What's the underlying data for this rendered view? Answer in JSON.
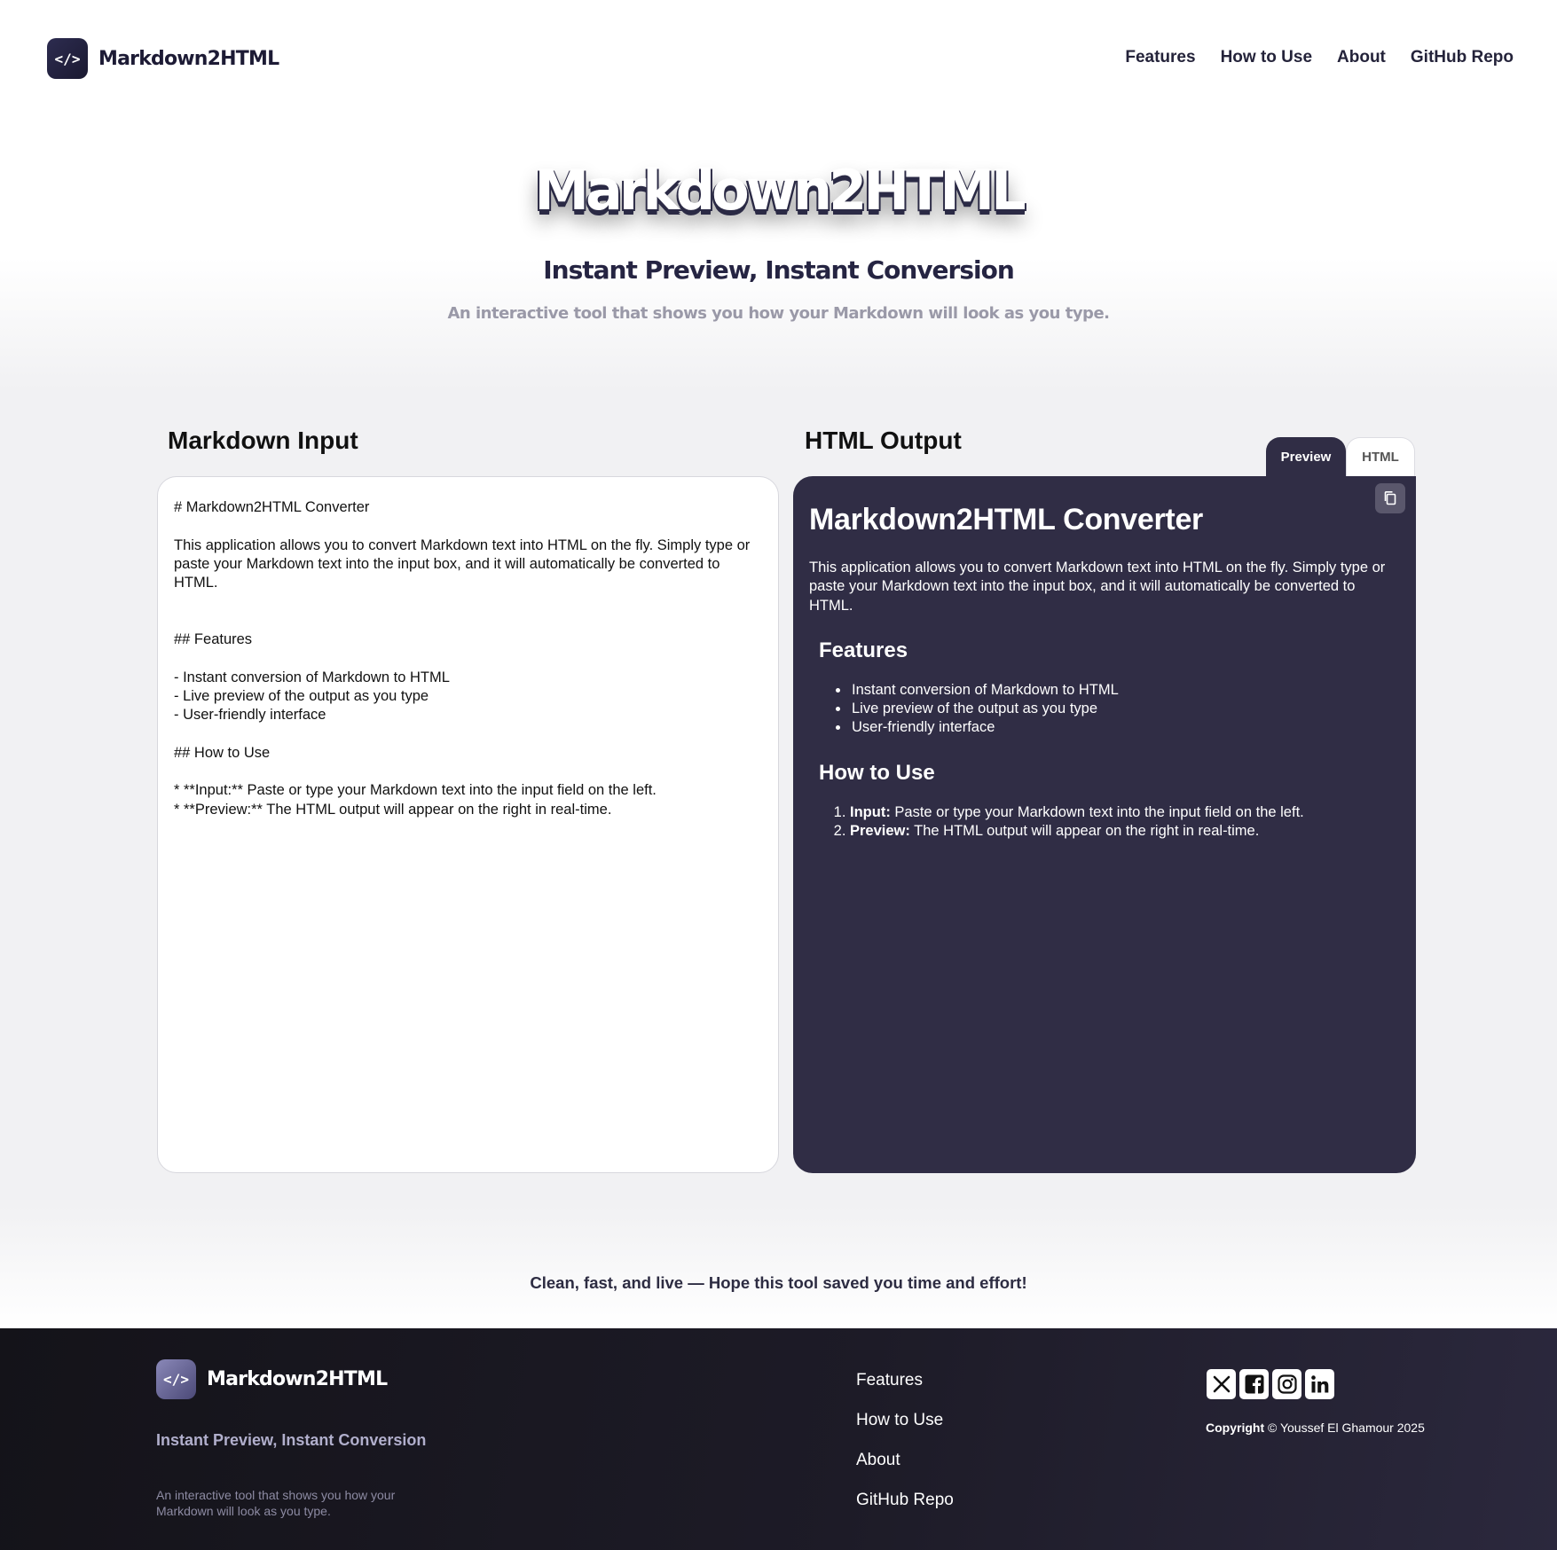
{
  "app": {
    "brand": "Markdown2HTML",
    "logo_glyph": "</>"
  },
  "nav": {
    "items": [
      "Features",
      "How to Use",
      "About",
      "GitHub Repo"
    ]
  },
  "hero": {
    "title": "Markdown2HTML",
    "subtitle": "Instant Preview, Instant Conversion",
    "tagline": "An interactive tool that shows you how your Markdown will look as you type."
  },
  "input_panel": {
    "title": "Markdown Input",
    "value": "# Markdown2HTML Converter\n\nThis application allows you to convert Markdown text into HTML on the fly. Simply type or paste your Markdown text into the input box, and it will automatically be converted to HTML.\n\n\n## Features\n\n- Instant conversion of Markdown to HTML\n- Live preview of the output as you type\n- User-friendly interface\n\n## How to Use\n\n* **Input:** Paste or type your Markdown text into the input field on the left.\n* **Preview:** The HTML output will appear on the right in real-time."
  },
  "output_panel": {
    "title": "HTML Output",
    "tabs": [
      "Preview",
      "HTML"
    ],
    "active_tab": "Preview",
    "copy_icon": "copy-icon",
    "preview": {
      "h1": "Markdown2HTML Converter",
      "paragraph": "This application allows you to convert Markdown text into HTML on the fly. Simply type or paste your Markdown text into the input box, and it will automatically be converted to HTML.",
      "features_heading": "Features",
      "features": [
        "Instant conversion of Markdown to HTML",
        "Live preview of the output as you type",
        "User-friendly interface"
      ],
      "howto_heading": "How to Use",
      "steps": [
        {
          "bold": "Input:",
          "text": " Paste or type your Markdown text into the input field on the left."
        },
        {
          "bold": "Preview:",
          "text": " The HTML output will appear on the right in real-time."
        }
      ]
    }
  },
  "closing": "Clean, fast, and live — Hope this tool saved you time and effort!",
  "footer": {
    "brand": "Markdown2HTML",
    "subtitle": "Instant Preview, Instant Conversion",
    "tagline": "An interactive tool that shows you how your Markdown will look as you type.",
    "links": [
      "Features",
      "How to Use",
      "About",
      "GitHub Repo"
    ],
    "socials": [
      "x-icon",
      "facebook-icon",
      "instagram-icon",
      "linkedin-icon"
    ],
    "copyright_label": "Copyright",
    "copyright_text": " © Youssef El Ghamour 2025"
  },
  "colors": {
    "accent_dark": "#302d45",
    "brand_text": "#1d1b35",
    "footer_bg": "#141319"
  }
}
